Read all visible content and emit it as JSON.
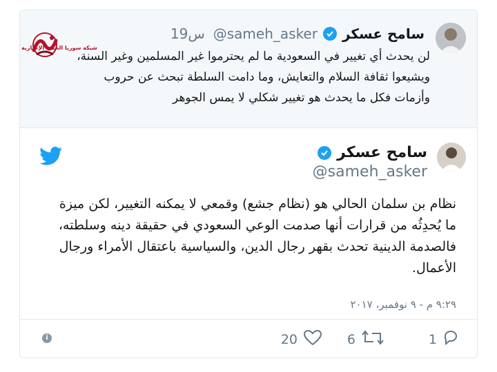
{
  "watermark": {
    "brand": "شبكة سوريا الحدث الإخبارية"
  },
  "prev_tweet": {
    "name": "سامح عسكر",
    "handle": "@sameh_asker",
    "time": "19س",
    "text": "لن يحدث أي تغيير في السعودية ما لم يحترموا غير المسلمين وغير السنة، ويشيعوا ثقافة السلام والتعايش، وما دامت السلطة تبحث عن حروب وأزمات فكل ما يحدث هو تغيير شكلي لا يمس الجوهر"
  },
  "tweet": {
    "name": "سامح عسكر",
    "handle": "@sameh_asker",
    "text": "نظام بن سلمان الحالي هو (نظام جشع) وقمعي لا يمكنه التغيير، لكن ميزة ما يُحدِثُه من قرارات أنها صدمت الوعي السعودي في حقيقة دينه وسلطته، فالصدمة الدينية تحدث بقهر رجال الدين، والسياسية باعتقال الأمراء ورجال الأعمال.",
    "timestamp": "٩:٢٩ م - ٩ نوفمبر، ٢٠١٧"
  },
  "actions": {
    "reply_count": "1",
    "retweet_count": "6",
    "like_count": "20",
    "info_glyph": "i"
  },
  "colors": {
    "accent": "#1da1f2",
    "muted": "#657786",
    "watermark": "#b3122b"
  },
  "icons": [
    "twitter-bird-icon",
    "verified-badge-icon",
    "reply-icon",
    "retweet-icon",
    "like-icon",
    "info-icon"
  ]
}
